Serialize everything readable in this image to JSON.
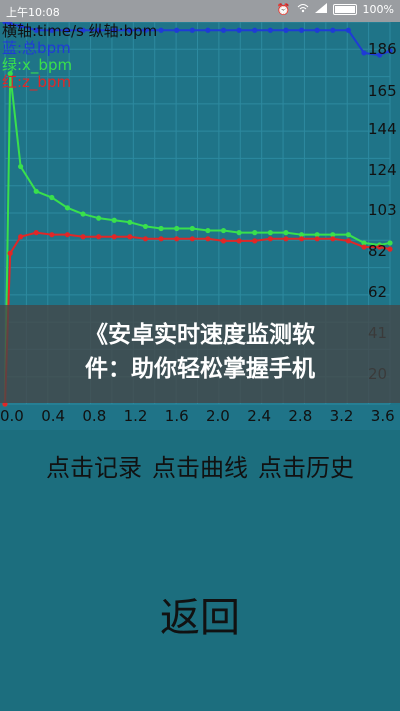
{
  "status_bar": {
    "time": "上午10:08",
    "icons": [
      "alarm-icon",
      "wifi-icon",
      "signal-icon"
    ],
    "battery": "100%"
  },
  "chart_data": {
    "type": "line",
    "title": "横轴:time/s 纵轴:bpm",
    "legend": [
      "蓝:总bpm",
      "绿:x_bpm",
      "红:z_bpm"
    ],
    "x": [
      0.0,
      0.05,
      0.15,
      0.3,
      0.45,
      0.6,
      0.75,
      0.9,
      1.05,
      1.2,
      1.35,
      1.5,
      1.65,
      1.8,
      1.95,
      2.1,
      2.25,
      2.4,
      2.55,
      2.7,
      2.85,
      3.0,
      3.15,
      3.3,
      3.45,
      3.6,
      3.7
    ],
    "xlim": [
      0.0,
      3.7
    ],
    "x_ticks": [
      "0.0",
      "0.4",
      "0.8",
      "1.2",
      "1.6",
      "2.0",
      "2.4",
      "2.8",
      "3.2",
      "3.6"
    ],
    "ylim": [
      15,
      200
    ],
    "y_ticks": [
      "186",
      "165",
      "144",
      "124",
      "103",
      "82",
      "62",
      "41",
      "20"
    ],
    "series": [
      {
        "name": "蓝:总bpm",
        "color": "#1f3bd6",
        "values": [
          200,
          199,
          198,
          196,
          196,
          196,
          196,
          196,
          196,
          196,
          196,
          196,
          196,
          196,
          196,
          196,
          196,
          196,
          196,
          196,
          196,
          196,
          196,
          196,
          185,
          184,
          186
        ]
      },
      {
        "name": "绿:x_bpm",
        "color": "#39e04c",
        "values": [
          15,
          175,
          130,
          118,
          115,
          110,
          107,
          105,
          104,
          103,
          101,
          100,
          100,
          100,
          99,
          99,
          98,
          98,
          98,
          98,
          97,
          97,
          97,
          97,
          93,
          92,
          93
        ]
      },
      {
        "name": "红:z_bpm",
        "color": "#e02727",
        "values": [
          15,
          88,
          96,
          98,
          97,
          97,
          96,
          96,
          96,
          96,
          95,
          95,
          95,
          95,
          95,
          94,
          94,
          94,
          95,
          95,
          95,
          95,
          95,
          94,
          91,
          91,
          90
        ]
      }
    ]
  },
  "banner": {
    "line1": "《安卓实时速度监测软",
    "line2": "件：助你轻松掌握手机"
  },
  "buttons": {
    "record": "点击记录",
    "curve": "点击曲线",
    "history": "点击历史",
    "back": "返回"
  }
}
